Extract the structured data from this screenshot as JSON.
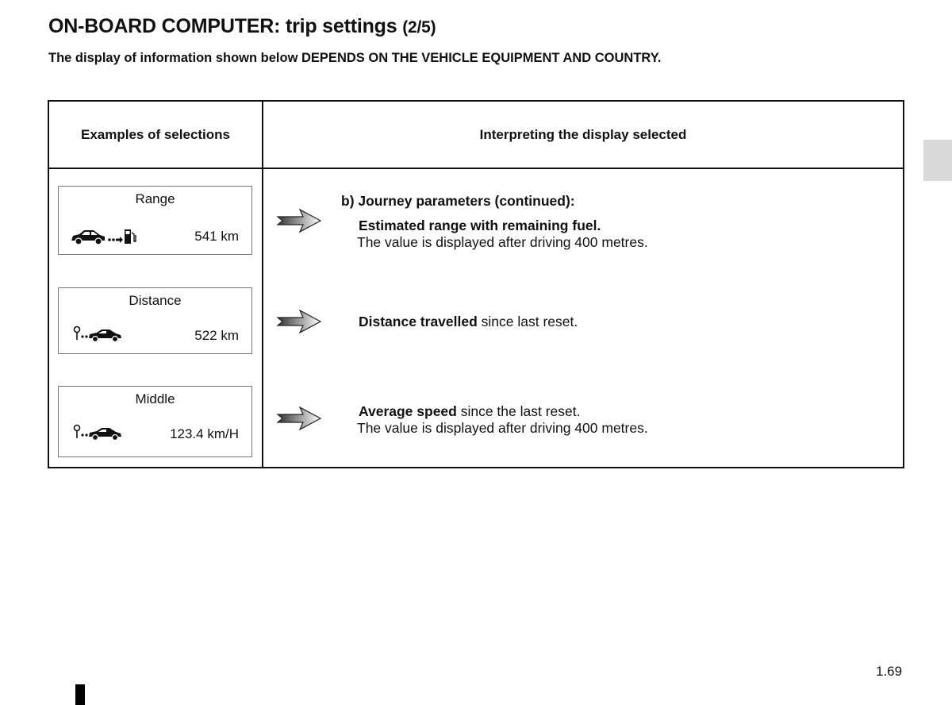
{
  "header": {
    "title": "ON-BOARD COMPUTER: trip settings",
    "page_indicator": "(2/5)",
    "subtitle": "The display of information shown below DEPENDS ON THE VEHICLE EQUIPMENT AND COUNTRY."
  },
  "table": {
    "col_headers": [
      "Examples of selections",
      "Interpreting the display selected"
    ],
    "rows": [
      {
        "display": {
          "label": "Range",
          "icon": "car-to-fuel-pump-icon",
          "value": "541 km"
        },
        "section_heading": "b) Journey parameters (continued):",
        "bold_text": "Estimated range with remaining fuel.",
        "normal_text": "",
        "second_line": "The value is displayed after driving 400 metres."
      },
      {
        "display": {
          "label": "Distance",
          "icon": "pin-to-car-icon",
          "value": "522 km"
        },
        "bold_text": "Distance travelled",
        "normal_text": " since last reset.",
        "second_line": ""
      },
      {
        "display": {
          "label": "Middle",
          "icon": "pin-to-car-icon",
          "value": "123.4 km/H"
        },
        "bold_text": "Average speed",
        "normal_text": " since the last reset.",
        "second_line": "The value is displayed after driving 400 metres."
      }
    ]
  },
  "footer": {
    "page_number": "1.69"
  },
  "colors": {
    "text": "#111111",
    "box_border": "#777777",
    "tab_marker": "#d9d9d9"
  }
}
